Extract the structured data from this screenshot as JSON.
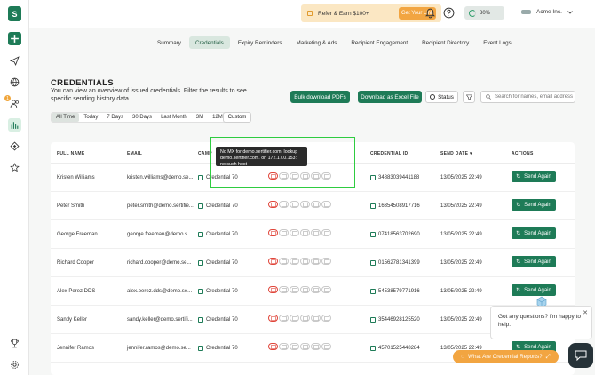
{
  "header": {
    "refer_label": "Refer & Earn $100+",
    "get_link_label": "Get Your Link",
    "credit_percent": "80%",
    "company_name": "Acme Inc."
  },
  "sidebar": {
    "badge_count": "1"
  },
  "nav": {
    "tabs": [
      {
        "label": "Summary"
      },
      {
        "label": "Credentials"
      },
      {
        "label": "Expiry Reminders"
      },
      {
        "label": "Marketing & Ads"
      },
      {
        "label": "Recipient Engagement"
      },
      {
        "label": "Recipient Directory"
      },
      {
        "label": "Event Logs"
      }
    ]
  },
  "page": {
    "title": "CREDENTIALS",
    "description": "You can view an overview of issued credentials. Filter the results to see specific sending history data.",
    "bulk_download_label": "Bulk download PDFs",
    "download_excel_label": "Download as Excel File",
    "status_label": "Status",
    "search_placeholder": "Search for names, email address"
  },
  "date_range": {
    "options": [
      "All Time",
      "Today",
      "7 Days",
      "30 Days",
      "Last Month",
      "3M",
      "12M"
    ],
    "custom_label": "Custom"
  },
  "table": {
    "headers": {
      "full_name": "FULL NAME",
      "email": "EMAIL",
      "campaign": "CAMP",
      "credential_id": "CREDENTIAL ID",
      "send_date": "SEND DATE",
      "actions": "ACTIONS"
    },
    "send_again_label": "Send Again",
    "rows": [
      {
        "name": "Kristen Williams",
        "email": "kristen.williams@demo.se...",
        "credential": "Credential 70",
        "id": "34883039441188",
        "date": "13/05/2025 22:49"
      },
      {
        "name": "Peter Smith",
        "email": "peter.smith@demo.sertifie...",
        "credential": "Credential 70",
        "id": "16354508917716",
        "date": "13/05/2025 22:49"
      },
      {
        "name": "George Freeman",
        "email": "george.freeman@demo.s...",
        "credential": "Credential 70",
        "id": "07418563702690",
        "date": "13/05/2025 22:49"
      },
      {
        "name": "Richard Cooper",
        "email": "richard.cooper@demo.se...",
        "credential": "Credential 70",
        "id": "01562781341399",
        "date": "13/05/2025 22:49"
      },
      {
        "name": "Alex Perez DDS",
        "email": "alex.perez.dds@demo.se...",
        "credential": "Credential 70",
        "id": "54538579771916",
        "date": "13/05/2025 22:49"
      },
      {
        "name": "Sandy Keller",
        "email": "sandy.keller@demo.sertifi...",
        "credential": "Credential 70",
        "id": "35446928125520",
        "date": "13/05/2025 22:49"
      },
      {
        "name": "Jennifer Ramos",
        "email": "jennifer.ramos@demo.se...",
        "credential": "Credential 70",
        "id": "45701525448284",
        "date": "13/05/2025 22:49"
      }
    ]
  },
  "tooltip": {
    "text": "No MX for demo.sertifier.com, lookup demo.sertifier.com. on 172.17.0.153: no such host"
  },
  "chat": {
    "message": "Got any questions? I'm happy to help.",
    "faq_label": "What Are Credential Reports?"
  },
  "colors": {
    "primary": "#1e7b57",
    "accent": "#f2a541",
    "error": "#e0453a"
  }
}
